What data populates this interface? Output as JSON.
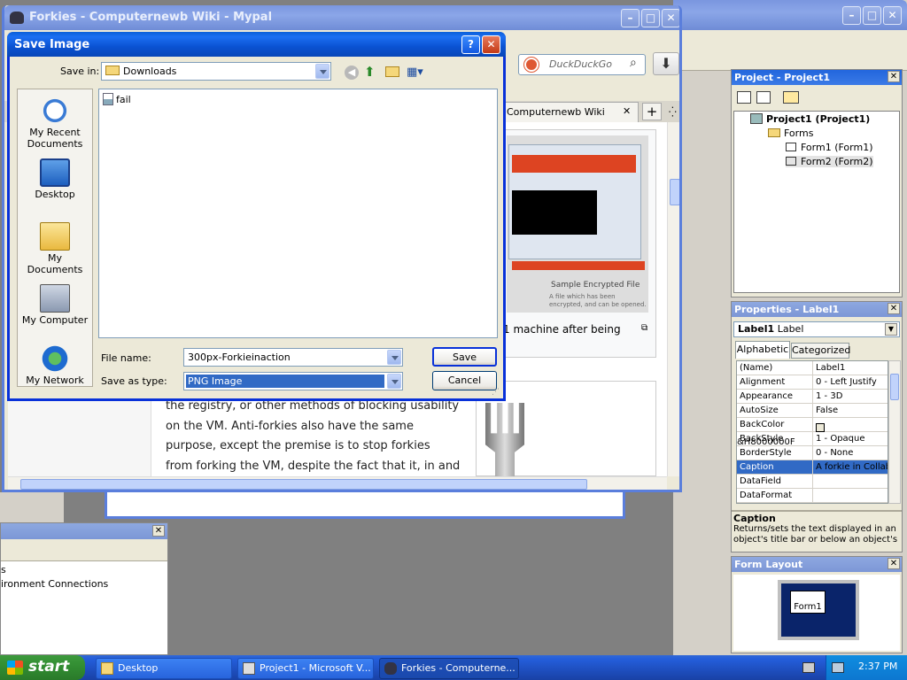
{
  "browser": {
    "title": "Forkies - Computernewb Wiki - Mypal",
    "search_placeholder": "DuckDuckGo",
    "tab_label": "Computernewb Wiki",
    "caption": "1 machine after being",
    "thumb_caption": "A file which has been encrypted, and can be opened.",
    "thumb_label": "Sample Encrypted File",
    "article_lines": [
      "the registry, or other methods of blocking usability",
      "on the VM. Anti-forkies also have the same",
      "purpose, except the premise is to stop forkies",
      "from forking the VM, despite the fact that it, in and"
    ]
  },
  "dialog": {
    "title": "Save Image",
    "help": "?",
    "save_in_label": "Save in:",
    "save_in_value": "Downloads",
    "places": [
      {
        "label": "My Recent Documents"
      },
      {
        "label": "Desktop"
      },
      {
        "label": "My Documents"
      },
      {
        "label": "My Computer"
      },
      {
        "label": "My Network"
      }
    ],
    "files": [
      {
        "name": "fail"
      }
    ],
    "filename_label": "File name:",
    "filename_value": "300px-Forkieinaction",
    "type_label": "Save as type:",
    "type_value": "PNG Image",
    "save_label": "Save",
    "cancel_label": "Cancel"
  },
  "project": {
    "title": "Project - Project1",
    "tree": [
      {
        "label": "Project1 (Project1)"
      },
      {
        "label": "Forms"
      },
      {
        "label": "Form1 (Form1)"
      },
      {
        "label": "Form2 (Form2)"
      }
    ]
  },
  "properties": {
    "title": "Properties - Label1",
    "object_name": "Label1",
    "object_type": "Label",
    "tab_alpha": "Alphabetic",
    "tab_cat": "Categorized",
    "rows": [
      {
        "name": "(Name)",
        "value": "Label1"
      },
      {
        "name": "Alignment",
        "value": "0 - Left Justify"
      },
      {
        "name": "Appearance",
        "value": "1 - 3D"
      },
      {
        "name": "AutoSize",
        "value": "False"
      },
      {
        "name": "BackColor",
        "value": "&H8000000F"
      },
      {
        "name": "BackStyle",
        "value": "1 - Opaque"
      },
      {
        "name": "BorderStyle",
        "value": "0 - None"
      },
      {
        "name": "Caption",
        "value": "A forkie in Collab"
      },
      {
        "name": "DataField",
        "value": ""
      },
      {
        "name": "DataFormat",
        "value": ""
      }
    ],
    "desc_title": "Caption",
    "desc_text": "Returns/sets the text displayed in an object's title bar or below an object's"
  },
  "form_layout": {
    "title": "Form Layout",
    "form_label": "Form1"
  },
  "bottom_panel": {
    "lines": [
      "s",
      "ironment Connections"
    ]
  },
  "taskbar": {
    "start": "start",
    "items": [
      {
        "label": "Desktop"
      },
      {
        "label": "Project1 - Microsoft V..."
      },
      {
        "label": "Forkies - Computerne..."
      }
    ],
    "clock": "2:37 PM"
  }
}
